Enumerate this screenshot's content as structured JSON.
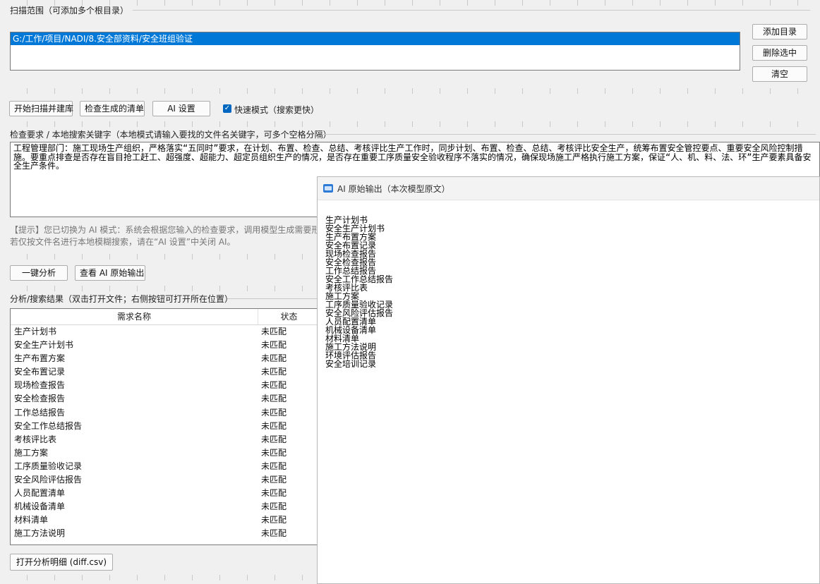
{
  "scan": {
    "group_title": "扫描范围（可添加多个根目录）",
    "selected_path": "G:/工作/项目/NADI/8.安全部资料/安全班组验证",
    "add_dir": "添加目录",
    "remove_selected": "删除选中",
    "clear": "清空"
  },
  "actions": {
    "start_scan": "开始扫描并建库",
    "check_list": "检查生成的清单",
    "ai_settings": "AI 设置",
    "fast_mode_label": "快速模式（搜索更快）",
    "fast_mode_checked": true
  },
  "requirements": {
    "group_title": "检查要求 / 本地搜索关键字（本地模式请输入要找的文件名关键字，可多个空格分隔）",
    "text": "工程管理部门：施工现场生产组织，严格落实“五同时”要求，在计划、布置、检查、总结、考核评比生产工作时，同步计划、布置、检查、总结、考核评比安全生产，统筹布置安全管控要点、重要安全风险控制措施。要重点排查是否存在盲目抢工赶工、超强度、超能力、超定员组织生产的情况，是否存在重要工序质量安全验收程序不落实的情况，确保现场施工严格执行施工方案，保证“人、机、料、法、环”生产要素具备安全生产条件。",
    "hint_line1": "【提示】您已切换为 AI 模式：系统会根据您输入的检查要求，调用模型生成需要形",
    "hint_line2": "若仅按文件名进行本地模糊搜索，请在“AI 设置”中关闭 AI。"
  },
  "analysis": {
    "one_click": "一键分析",
    "view_raw": "查看 AI 原始输出",
    "results_title": "分析/搜索结果（双击打开文件；右侧按钮可打开所在位置）",
    "col_name": "需求名称",
    "col_status": "状态",
    "rows": [
      {
        "name": "生产计划书",
        "status": "未匹配"
      },
      {
        "name": "安全生产计划书",
        "status": "未匹配"
      },
      {
        "name": "生产布置方案",
        "status": "未匹配"
      },
      {
        "name": "安全布置记录",
        "status": "未匹配"
      },
      {
        "name": "现场检查报告",
        "status": "未匹配"
      },
      {
        "name": "安全检查报告",
        "status": "未匹配"
      },
      {
        "name": "工作总结报告",
        "status": "未匹配"
      },
      {
        "name": "安全工作总结报告",
        "status": "未匹配"
      },
      {
        "name": "考核评比表",
        "status": "未匹配"
      },
      {
        "name": "施工方案",
        "status": "未匹配"
      },
      {
        "name": "工序质量验收记录",
        "status": "未匹配"
      },
      {
        "name": "安全风险评估报告",
        "status": "未匹配"
      },
      {
        "name": "人员配置清单",
        "status": "未匹配"
      },
      {
        "name": "机械设备清单",
        "status": "未匹配"
      },
      {
        "name": "材料清单",
        "status": "未匹配"
      },
      {
        "name": "施工方法说明",
        "status": "未匹配"
      }
    ],
    "open_detail": "打开分析明细 (diff.csv)"
  },
  "popup": {
    "title": "AI 原始输出（本次模型原文）",
    "lines": [
      "生产计划书",
      "安全生产计划书",
      "生产布置方案",
      "安全布置记录",
      "现场检查报告",
      "安全检查报告",
      "工作总结报告",
      "安全工作总结报告",
      "考核评比表",
      "施工方案",
      "工序质量验收记录",
      "安全风险评估报告",
      "人员配置清单",
      "机械设备清单",
      "材料清单",
      "施工方法说明",
      "环境评估报告",
      "安全培训记录"
    ]
  }
}
